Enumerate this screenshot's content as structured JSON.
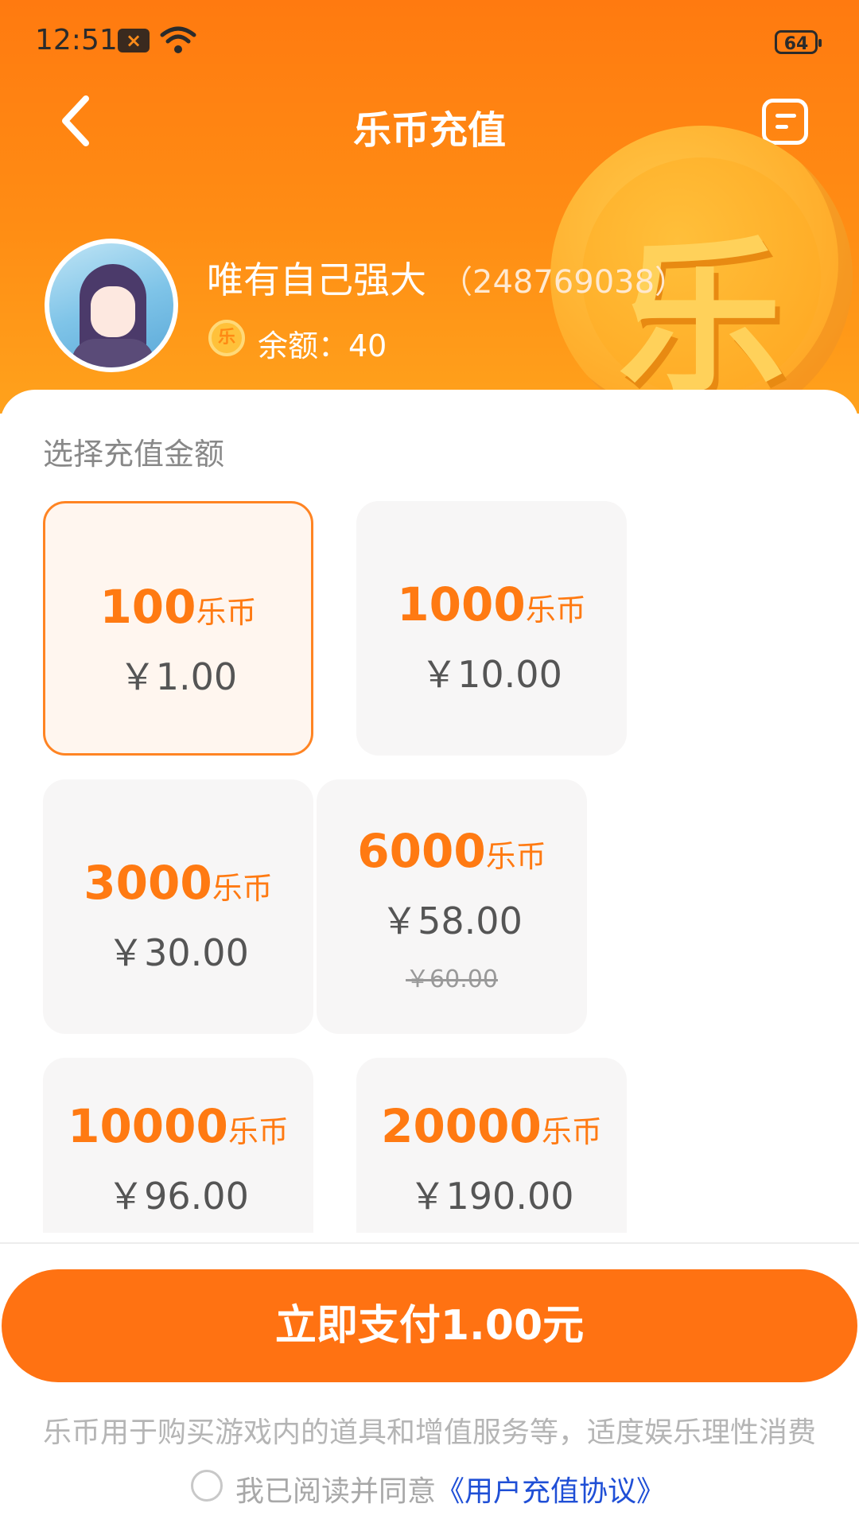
{
  "status_bar": {
    "time": "12:51",
    "notification_badge": "×",
    "battery": "64"
  },
  "nav": {
    "title": "乐币充值"
  },
  "user": {
    "name": "唯有自己强大",
    "uid": "（248769038）",
    "coin_glyph": "乐",
    "balance_label": "余额：40"
  },
  "header_coin_glyph": "乐",
  "recharge": {
    "section_title": "选择充值金额",
    "unit": "乐币",
    "options": [
      {
        "amount": "100",
        "price": "￥1.00",
        "selected": true
      },
      {
        "amount": "1000",
        "price": "￥10.00"
      },
      {
        "amount": "3000",
        "price": "￥30.00"
      },
      {
        "amount": "6000",
        "price": "￥58.00",
        "original_price": "￥60.00"
      },
      {
        "amount": "10000",
        "price": "￥96.00"
      },
      {
        "amount": "20000",
        "price": "￥190.00"
      }
    ]
  },
  "footer": {
    "pay_button": "立即支付1.00元",
    "notice": "乐币用于购买游戏内的道具和增值服务等，适度娱乐理性消费",
    "agree_prefix": "我已阅读并同意",
    "agree_link": "《用户充值协议》"
  },
  "colors": {
    "accent": "#ff7a12",
    "header_top": "#ff7a10",
    "header_bottom": "#ffa21c",
    "card_bg": "#f7f6f6",
    "link": "#1f4fd6"
  }
}
